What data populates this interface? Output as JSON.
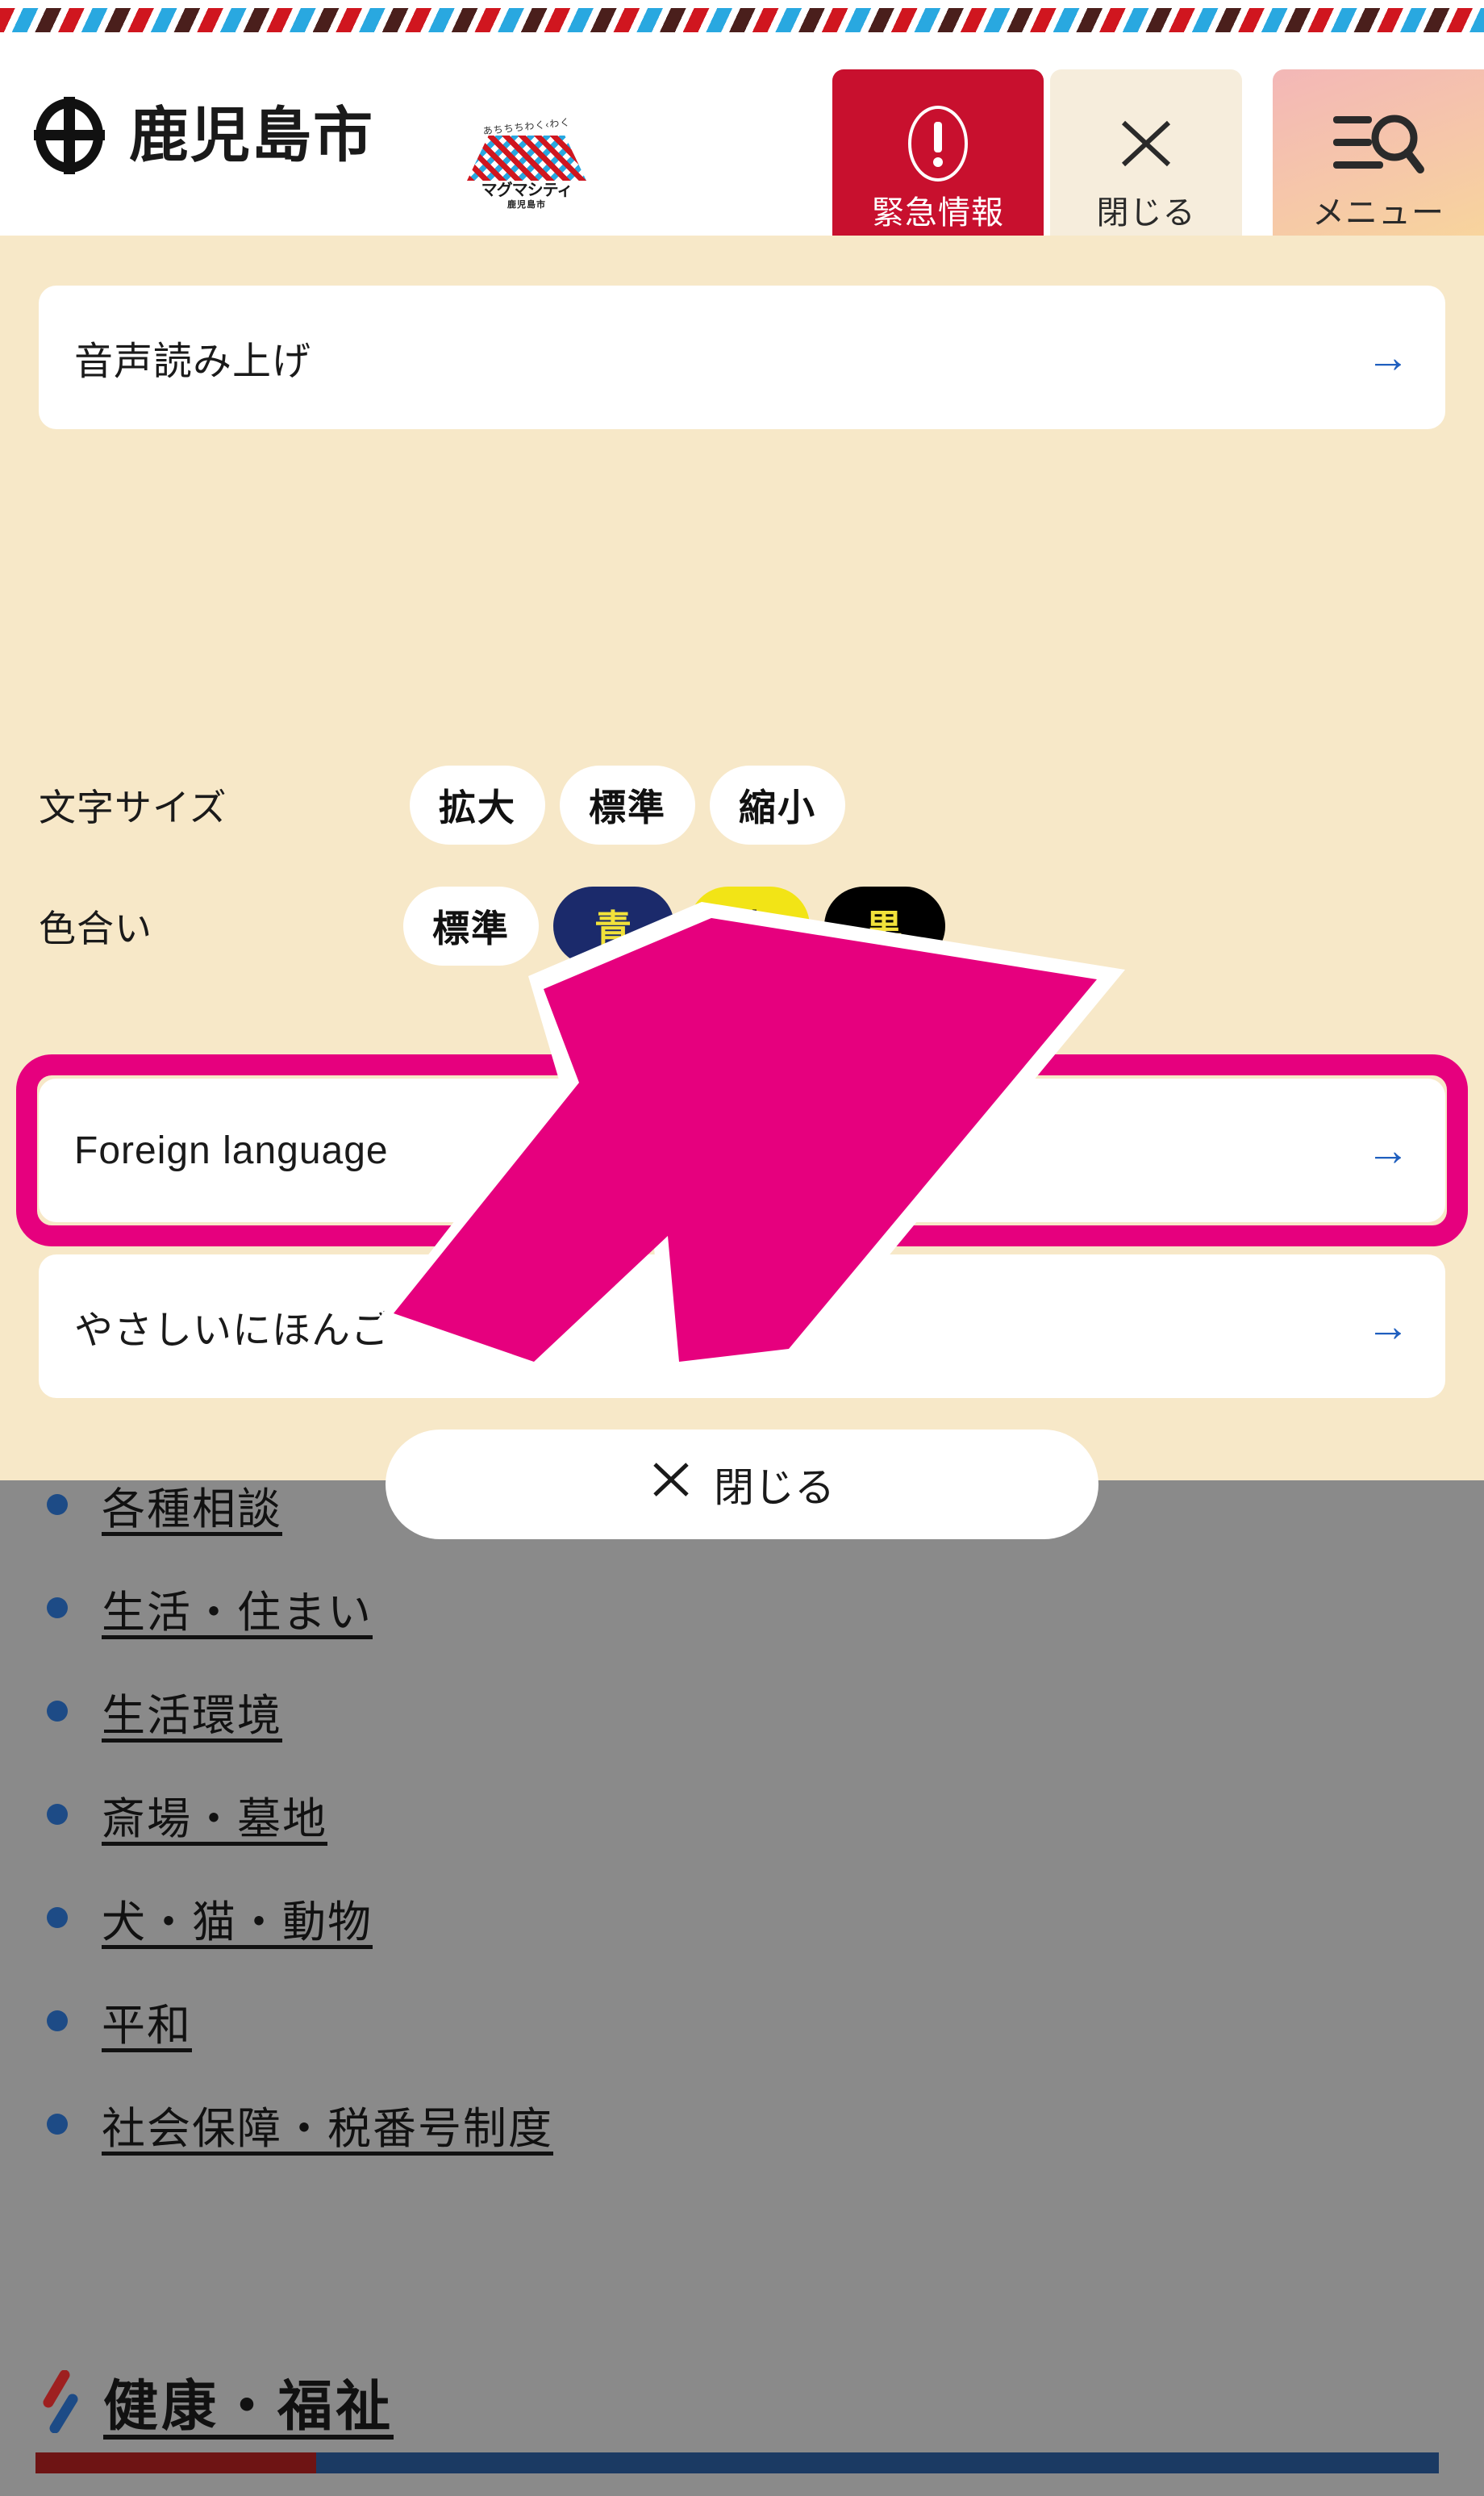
{
  "header": {
    "city_name": "鹿児島市",
    "emblem_icon": "kagoshima-city-emblem",
    "magma_logo": {
      "top_text": "あちちちわく‹わく",
      "name": "マグマシティ",
      "sub": "鹿児島市"
    },
    "buttons": [
      {
        "id": "emergency",
        "label": "緊急情報",
        "icon": "alert-exclamation-icon",
        "bg": "#c8102e",
        "fg": "#ffffff"
      },
      {
        "id": "close",
        "label": "閉じる",
        "icon": "close-x-icon",
        "bg": "#f6eddc",
        "fg": "#2a2a2a"
      },
      {
        "id": "menu",
        "label": "メニュー",
        "icon": "menu-search-icon",
        "bg": "#f3b7b7",
        "fg": "#2a2a2a"
      }
    ]
  },
  "panel": {
    "background": "#f7e8c8",
    "speech": {
      "label": "音声読み上げ",
      "arrow": "→"
    },
    "fontsize": {
      "label": "文字サイズ",
      "options": [
        {
          "label": "拡大",
          "bg": "#ffffff",
          "fg": "#111111"
        },
        {
          "label": "標準",
          "bg": "#ffffff",
          "fg": "#111111"
        },
        {
          "label": "縮小",
          "bg": "#ffffff",
          "fg": "#111111"
        }
      ]
    },
    "color": {
      "label": "色合い",
      "options": [
        {
          "label": "標準",
          "bg": "#ffffff",
          "fg": "#111111"
        },
        {
          "label": "青",
          "bg": "#1b2a6b",
          "fg": "#f2e23a"
        },
        {
          "label": "黄",
          "bg": "#f2e416",
          "fg": "#111111"
        },
        {
          "label": "黒",
          "bg": "#000000",
          "fg": "#f2e23a"
        }
      ]
    },
    "foreign": {
      "label": "Foreign language",
      "arrow": "→",
      "highlight_color": "#e6007e"
    },
    "easy_japanese": {
      "label": "やさしいにほんご",
      "arrow": "→"
    },
    "close_button": {
      "label": "閉じる",
      "icon": "close-x-icon"
    }
  },
  "annotation": {
    "arrow_color": "#e6007e",
    "arrow_outline": "#ffffff",
    "target": "Foreign language"
  },
  "content": {
    "overlay_color": "#8a8a8a",
    "links": [
      "各種相談",
      "生活・住まい",
      "生活環境",
      "斎場・墓地",
      "犬・猫・動物",
      "平和",
      "社会保障・税番号制度"
    ],
    "section_heading": {
      "label": "健康・福祉",
      "icon": "double-slash-icon"
    },
    "bottom_bar": {
      "left_color": "#6e1414",
      "right_color": "#1b3a63"
    }
  }
}
